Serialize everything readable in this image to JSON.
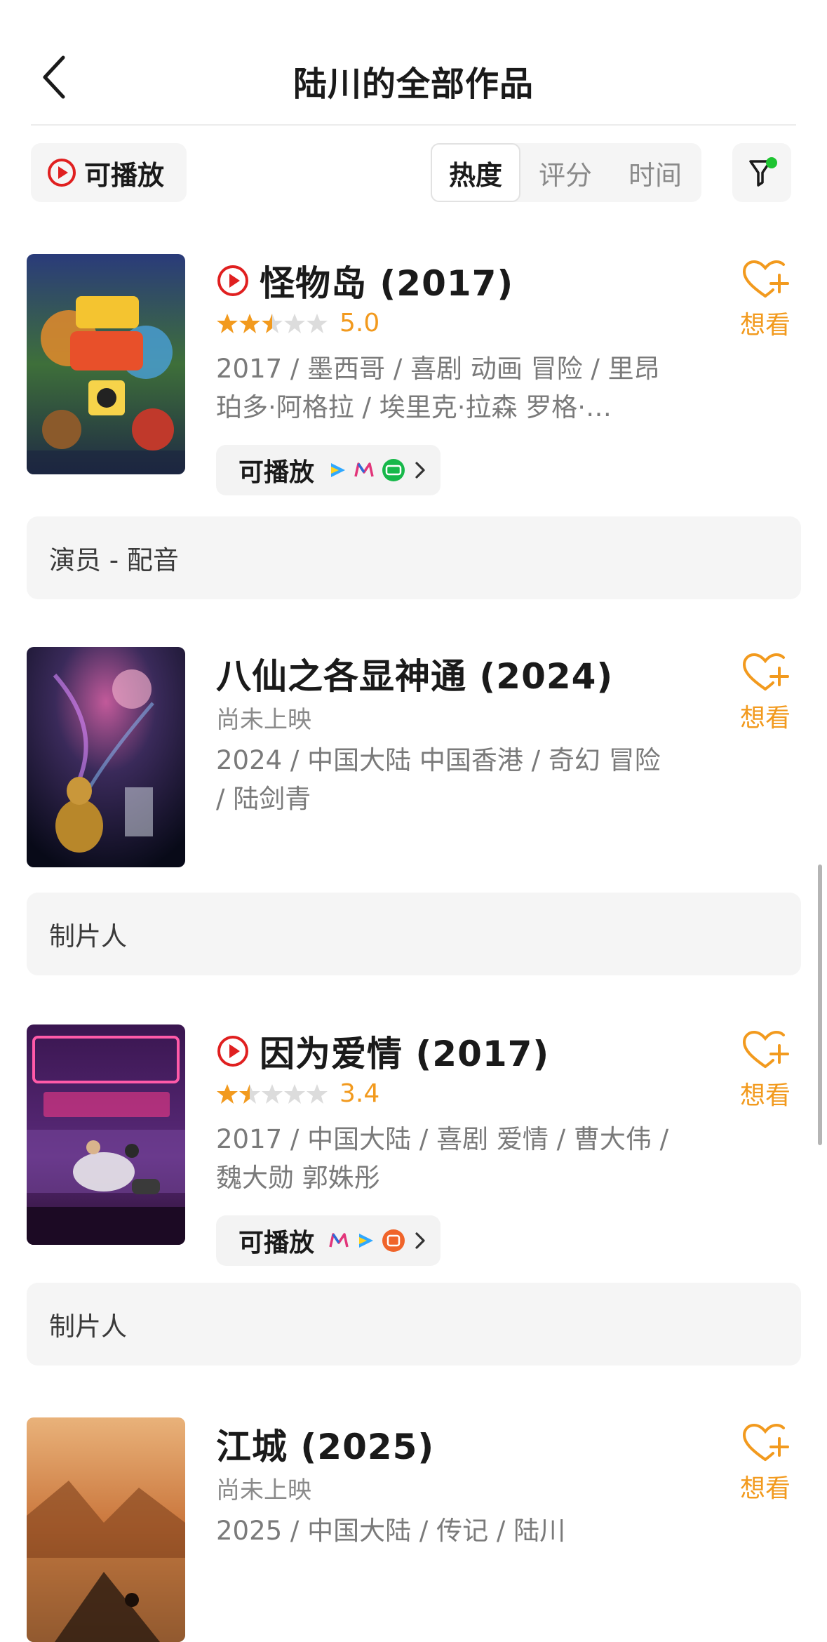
{
  "header": {
    "title": "陆川的全部作品"
  },
  "toolbar": {
    "playable_label": "可播放",
    "sort_tabs": [
      "热度",
      "评分",
      "时间"
    ],
    "active_sort": "热度"
  },
  "colors": {
    "accent": "#f29a1e",
    "play_red": "#e02020",
    "filter_dot": "#1ec431"
  },
  "movies": [
    {
      "title": "怪物岛",
      "year": "(2017)",
      "playable": true,
      "rating": 2.5,
      "score": "5.0",
      "meta": "2017 / 墨西哥 / 喜剧 动画 冒险 / 里昂珀多·阿格拉 / 埃里克·拉森 罗格·…",
      "play_chip": "可播放",
      "platforms": [
        "tencent-video-icon",
        "mango-tv-icon",
        "iqiyi-icon"
      ],
      "want_label": "想看",
      "role": "演员 - 配音"
    },
    {
      "title": "八仙之各显神通",
      "year": "(2024)",
      "playable": false,
      "status": "尚未上映",
      "meta": "2024 / 中国大陆 中国香港 / 奇幻 冒险 / 陆剑青",
      "want_label": "想看",
      "role": "制片人"
    },
    {
      "title": "因为爱情",
      "year": "(2017)",
      "playable": true,
      "rating": 1.5,
      "score": "3.4",
      "meta": "2017 / 中国大陆 / 喜剧 爱情 / 曹大伟 / 魏大勋 郭姝彤",
      "play_chip": "可播放",
      "platforms": [
        "mango-tv-icon",
        "tencent-video-icon",
        "youku-icon"
      ],
      "want_label": "想看",
      "role": "制片人"
    },
    {
      "title": "江城",
      "year": "(2025)",
      "playable": false,
      "status": "尚未上映",
      "meta": "2025 / 中国大陆 / 传记 / 陆川",
      "want_label": "想看"
    }
  ]
}
